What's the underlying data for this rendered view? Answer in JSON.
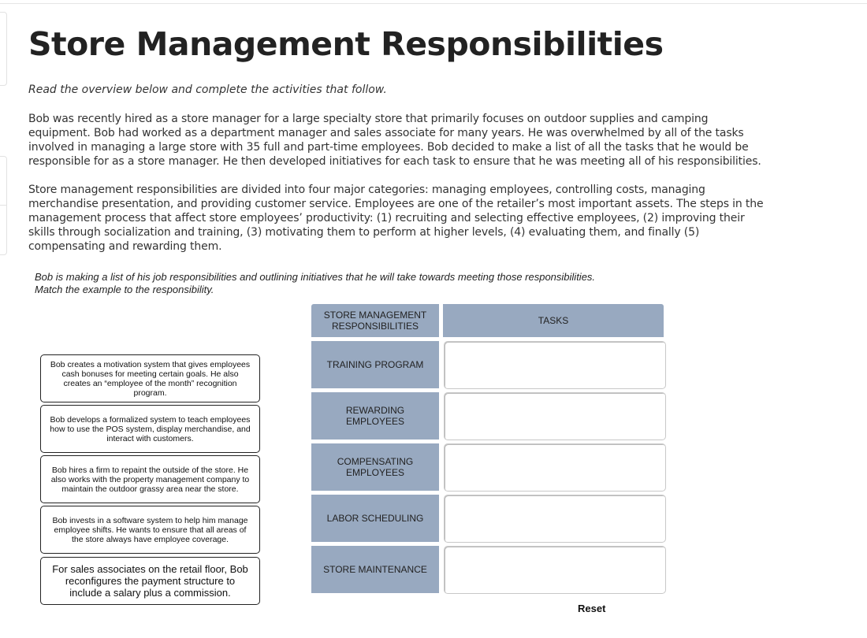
{
  "page": {
    "title": "Store Management Responsibilities",
    "intro": "Read the overview below and complete the activities that follow.",
    "paragraphs": [
      "Bob was recently hired as a store manager for a large specialty store that primarily focuses on outdoor supplies and camping equipment. Bob had worked as a department manager and sales associate for many years. He was overwhelmed by all of the tasks involved in managing a large store with 35 full and part-time employees. Bob decided to make a list of all the tasks that he would be responsible for as a store manager. He then developed initiatives for each task to ensure that he was meeting all of his responsibilities.",
      "Store management responsibilities are divided into four major categories: managing employees, controlling costs, managing merchandise presentation, and providing customer service. Employees are one of the retailer’s most important assets. The steps in the management process that affect store employees’ productivity: (1) recruiting and selecting effective employees, (2) improving their skills through socialization and training, (3) motivating them to perform at higher levels, (4) evaluating them, and finally (5) compensating and rewarding them."
    ]
  },
  "activity": {
    "instructions_line1": "Bob is making a list of his job responsibilities and outlining initiatives that he will take towards meeting those responsibilities.",
    "instructions_line2": "Match the example to the responsibility.",
    "cards": [
      "Bob creates a motivation system that gives employees cash bonuses for meeting certain goals. He also creates an “employee of the month” recognition program.",
      "Bob develops a formalized system to teach employees how to use the POS system, display merchandise, and interact with customers.",
      "Bob hires a firm to repaint the outside of the store. He also works with the property management company to maintain the outdoor grassy area near the store.",
      "Bob invests in a software system to help him manage employee shifts. He wants to ensure that all areas of the store always have employee coverage.",
      "For sales associates on the retail floor, Bob reconfigures the payment structure to include a salary plus a commission."
    ],
    "table": {
      "header_left": "STORE MANAGEMENT RESPONSIBILITIES",
      "header_right": "TASKS",
      "rows": [
        {
          "responsibility": "TRAINING PROGRAM",
          "task": ""
        },
        {
          "responsibility": "REWARDING EMPLOYEES",
          "task": ""
        },
        {
          "responsibility": "COMPENSATING EMPLOYEES",
          "task": ""
        },
        {
          "responsibility": "LABOR SCHEDULING",
          "task": ""
        },
        {
          "responsibility": "STORE MAINTENANCE",
          "task": ""
        }
      ]
    },
    "reset_label": "Reset",
    "colors": {
      "header_bg": "#98a9c0",
      "card_border": "#222222"
    }
  }
}
